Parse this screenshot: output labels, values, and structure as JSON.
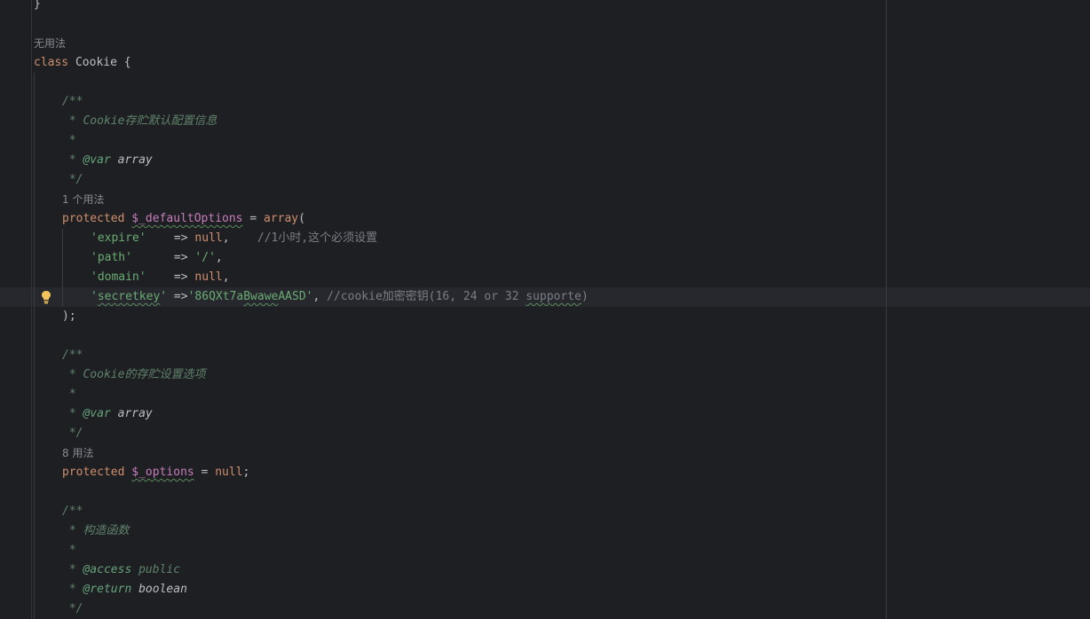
{
  "lines": {
    "l0": "}",
    "hint_class": "无用法",
    "class_kw": "class",
    "class_name": " Cookie {",
    "doc1_open": "/**",
    "doc1_desc": " * Cookie存贮默认配置信息",
    "doc1_star": " *",
    "doc1_var_prefix": " * ",
    "doc1_var_tag": "@var",
    "doc1_var_type": " array",
    "doc1_close": " */",
    "hint_default": "1 个用法",
    "default_kw": "protected",
    "default_sp": " ",
    "default_var": "$_defaultOptions",
    "default_eq": " = ",
    "default_fn": "array",
    "default_paren": "(",
    "expire_key": "'expire'",
    "expire_arrow": "    => ",
    "expire_val": "null",
    "expire_comma": ",    ",
    "expire_comment": "//1小时,这个必须设置",
    "path_key": "'path'",
    "path_arrow": "      => ",
    "path_val": "'/'",
    "path_comma": ",",
    "domain_key": "'domain'",
    "domain_arrow": "    => ",
    "domain_val": "null",
    "domain_comma": ",",
    "secret_q1": "'",
    "secret_key": "secretkey",
    "secret_q2": "'",
    "secret_arrow": " =>",
    "secret_val_a": "'86QXt7a",
    "secret_val_b": "Bwawe",
    "secret_val_c": "AASD'",
    "secret_comma": ", ",
    "secret_comment_a": "//cookie加密密钥(16, 24 or 32 ",
    "secret_comment_b": "supporte",
    "secret_comment_c": ")",
    "array_close": ");",
    "doc2_open": "/**",
    "doc2_desc": " * Cookie的存贮设置选项",
    "doc2_star": " *",
    "doc2_var_prefix": " * ",
    "doc2_var_tag": "@var",
    "doc2_var_type": " array",
    "doc2_close": " */",
    "hint_options": "8 用法",
    "options_kw": "protected",
    "options_sp": " ",
    "options_var": "$_options",
    "options_eq": " = ",
    "options_val": "null",
    "options_semi": ";",
    "doc3_open": "/**",
    "doc3_desc": " * 构造函数",
    "doc3_star": " *",
    "doc3_access_prefix": " * ",
    "doc3_access_tag": "@access",
    "doc3_access_val": " public",
    "doc3_return_prefix": " * ",
    "doc3_return_tag": "@return",
    "doc3_return_val": " boolean",
    "doc3_close": " */"
  },
  "icons": {
    "bulb": "lightbulb-icon"
  },
  "colors": {
    "background": "#1e1f22",
    "keyword": "#cf8e6d",
    "variable": "#c77dbb",
    "string": "#6aab73",
    "doc_comment": "#5f826b",
    "line_comment": "#7a7e85",
    "bulb": "#f2c55c"
  }
}
